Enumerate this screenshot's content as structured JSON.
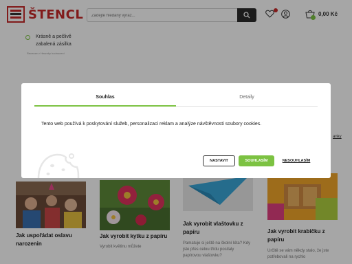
{
  "header": {
    "logo_text": "ŠTENCL",
    "search_placeholder": "Zadejte hledaný výraz...",
    "cart_price": "0,00 Kč"
  },
  "content": {
    "perk_text": "Krásně a pečlivě zabalená zásilka",
    "perk_sub": "Recenze z Heureky hodnocení",
    "link_fragment": "anky"
  },
  "cards": [
    {
      "title": "Jak uspořádat oslavu narozenin",
      "desc": ""
    },
    {
      "title": "Jak vyrobit kytku z papíru",
      "desc": "Vyrobit květinu můžete"
    },
    {
      "title": "Jak vyrobit vlaštovku z papíru",
      "desc": "Pamatuje si ještě na školní léta? Kdy jste přes celou třídu posílaly papírovou vlaštovku?"
    },
    {
      "title": "Jak vyrobit krabičku z papíru",
      "desc": "Určitě se vám někdy stalo, že jste potřebovali na rychlo"
    }
  ],
  "modal": {
    "tab_consent": "Souhlas",
    "tab_details": "Detaily",
    "text": "Tento web používá k poskytování služeb, personalizaci reklam a analýze návštěvnosti soubory cookies.",
    "btn_settings": "NASTAVIT",
    "btn_accept": "SOUHLASÍM",
    "btn_decline": "NESOUHLASÍM"
  },
  "colors": {
    "brand_red": "#c62828",
    "accent_green": "#7cc242",
    "dark": "#2b2b2b"
  }
}
